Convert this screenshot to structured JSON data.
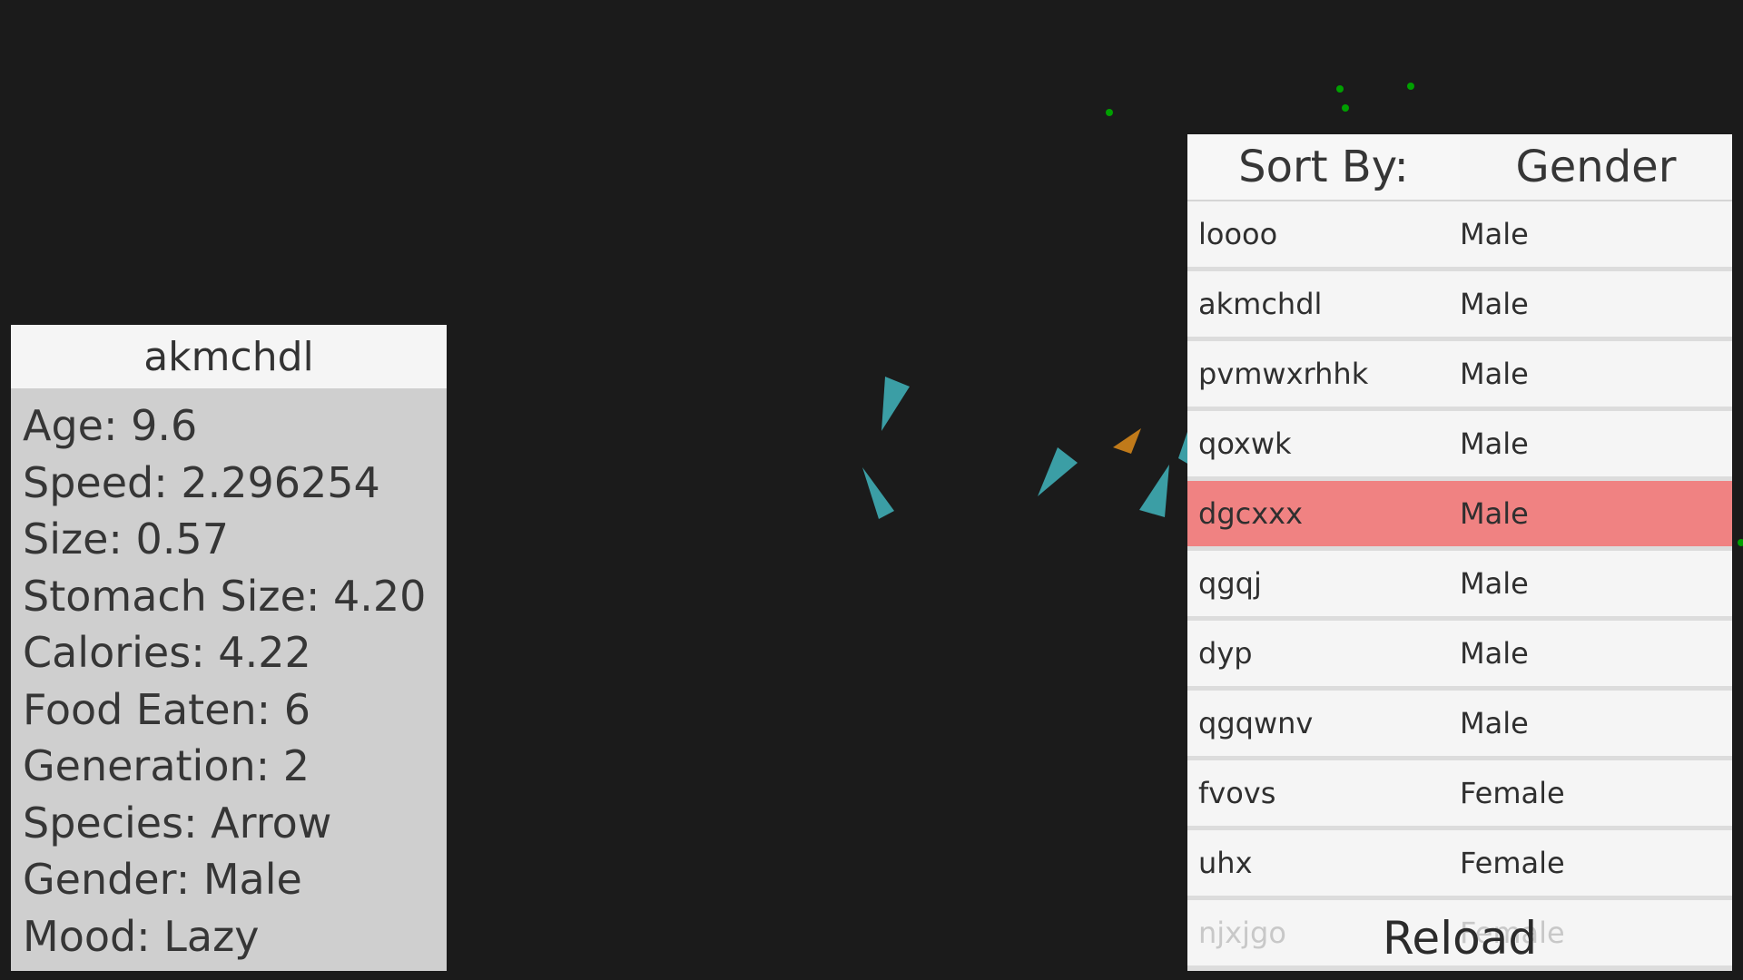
{
  "info_panel": {
    "title": "akmchdl",
    "stats": [
      "Age: 9.6",
      "Speed: 2.296254",
      "Size: 0.57",
      "Stomach Size: 4.20",
      "Calories: 4.22",
      "Food Eaten: 6",
      "Generation: 2",
      "Species: Arrow",
      "Gender: Male",
      "Mood: Lazy"
    ]
  },
  "list_panel": {
    "sort_label": "Sort By:",
    "sort_value": "Gender",
    "rows": [
      {
        "name": "loooo",
        "gender": "Male"
      },
      {
        "name": "akmchdl",
        "gender": "Male"
      },
      {
        "name": "pvmwxrhhk",
        "gender": "Male"
      },
      {
        "name": "qoxwk",
        "gender": "Male"
      },
      {
        "name": "dgcxxx",
        "gender": "Male"
      },
      {
        "name": "qgqj",
        "gender": "Male"
      },
      {
        "name": "dyp",
        "gender": "Male"
      },
      {
        "name": "qgqwnv",
        "gender": "Male"
      },
      {
        "name": "fvovs",
        "gender": "Female"
      },
      {
        "name": "uhx",
        "gender": "Female"
      },
      {
        "name": "njxjgo",
        "gender": "Female"
      }
    ],
    "reload_label": "Reload"
  },
  "colors": {
    "background": "#1b1b1b",
    "creature_arrow": "#3b9ea5",
    "creature_other": "#c07a1a",
    "food": "#00a000",
    "selected_row": "#f08282"
  }
}
